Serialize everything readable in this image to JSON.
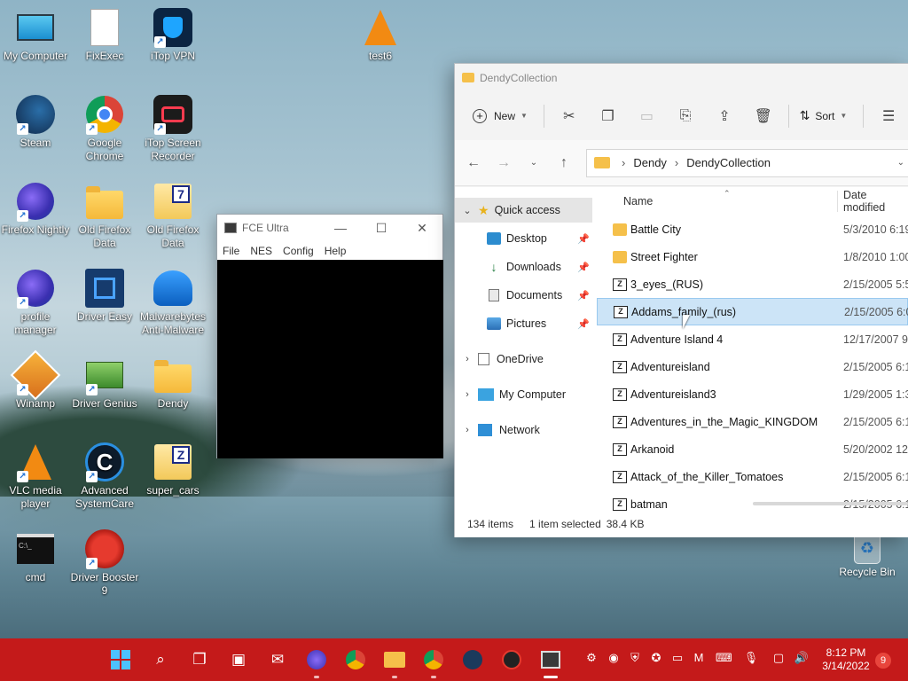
{
  "desktop": {
    "icons": [
      {
        "label": "My Computer"
      },
      {
        "label": "FixExec"
      },
      {
        "label": "iTop VPN"
      },
      {
        "label": "test6"
      },
      {
        "label": "Steam"
      },
      {
        "label": "Google Chrome"
      },
      {
        "label": "iTop Screen Recorder"
      },
      {
        "label": "Firefox Nightly"
      },
      {
        "label": "Old Firefox Data"
      },
      {
        "label": "Old Firefox Data"
      },
      {
        "label": "profile manager"
      },
      {
        "label": "Driver Easy"
      },
      {
        "label": "Malwarebytes Anti-Malware"
      },
      {
        "label": "Winamp"
      },
      {
        "label": "Driver Genius"
      },
      {
        "label": "Dendy"
      },
      {
        "label": "VLC media player"
      },
      {
        "label": "Advanced SystemCare"
      },
      {
        "label": "super_cars"
      },
      {
        "label": "cmd"
      },
      {
        "label": "Driver Booster 9"
      }
    ],
    "recycle_bin": "Recycle Bin"
  },
  "fce": {
    "title": "FCE Ultra",
    "menu": [
      "File",
      "NES",
      "Config",
      "Help"
    ]
  },
  "explorer": {
    "title": "DendyCollection",
    "toolbar": {
      "new_label": "New",
      "sort_label": "Sort"
    },
    "breadcrumb": [
      "Dendy",
      "DendyCollection"
    ],
    "nav": {
      "quick_access": "Quick access",
      "desktop": "Desktop",
      "downloads": "Downloads",
      "documents": "Documents",
      "pictures": "Pictures",
      "onedrive": "OneDrive",
      "my_computer": "My Computer",
      "network": "Network"
    },
    "columns": {
      "name": "Name",
      "date": "Date modified"
    },
    "files": [
      {
        "name": "Battle City",
        "date": "5/3/2010 6:19",
        "type": "folder"
      },
      {
        "name": "Street Fighter",
        "date": "1/8/2010 1:00",
        "type": "folder"
      },
      {
        "name": "3_eyes_(RUS)",
        "date": "2/15/2005 5:52",
        "type": "zip"
      },
      {
        "name": "Addams_family_(rus)",
        "date": "2/15/2005 6:07",
        "type": "zip",
        "selected": true
      },
      {
        "name": "Adventure Island 4",
        "date": "12/17/2007 9:2",
        "type": "zip"
      },
      {
        "name": "Adventureisland",
        "date": "2/15/2005 6:10",
        "type": "zip"
      },
      {
        "name": "Adventureisland3",
        "date": "1/29/2005 1:37",
        "type": "zip"
      },
      {
        "name": "Adventures_in_the_Magic_KINGDOM",
        "date": "2/15/2005 6:10",
        "type": "zip"
      },
      {
        "name": "Arkanoid",
        "date": "5/20/2002 12:0",
        "type": "zip"
      },
      {
        "name": "Attack_of_the_Killer_Tomatoes",
        "date": "2/15/2005 6:10",
        "type": "zip"
      },
      {
        "name": "batman",
        "date": "2/15/2005 6:10",
        "type": "zip"
      }
    ],
    "status": {
      "count": "134 items",
      "selected": "1 item selected",
      "size": "38.4 KB"
    }
  },
  "taskbar": {
    "time": "8:12 PM",
    "date": "3/14/2022",
    "notifications": "9",
    "accent": "#c41a1a"
  }
}
